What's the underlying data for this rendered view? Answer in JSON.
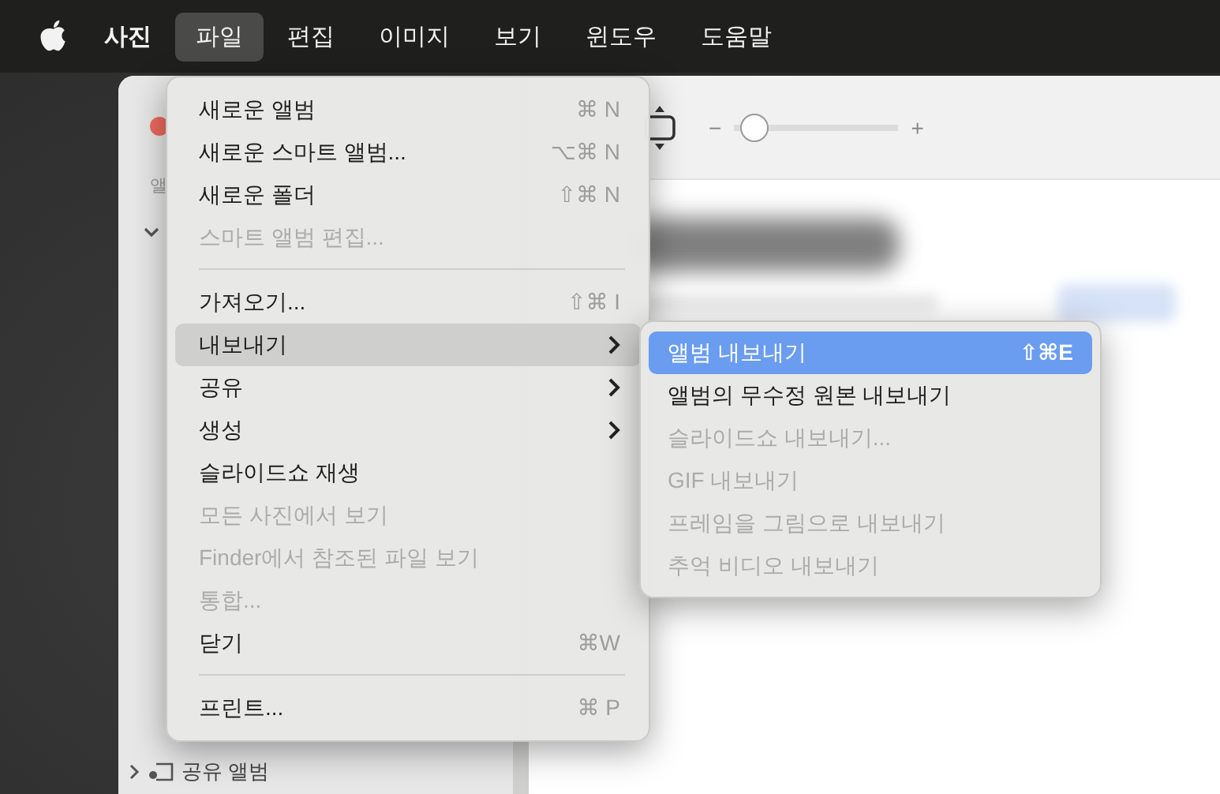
{
  "menu_bar": {
    "items": [
      {
        "label": "사진",
        "kind": "app",
        "selected": false
      },
      {
        "label": "파일",
        "kind": "menu",
        "selected": true
      },
      {
        "label": "편집",
        "kind": "menu",
        "selected": false
      },
      {
        "label": "이미지",
        "kind": "menu",
        "selected": false
      },
      {
        "label": "보기",
        "kind": "menu",
        "selected": false
      },
      {
        "label": "윈도우",
        "kind": "menu",
        "selected": false
      },
      {
        "label": "도움말",
        "kind": "menu",
        "selected": false
      }
    ]
  },
  "window": {
    "sidebar": {
      "heading": "앨",
      "items": [
        {
          "label": "공유 앨범",
          "expanded": false
        }
      ]
    }
  },
  "file_menu": {
    "items": [
      {
        "kind": "item",
        "label": "새로운 앨범",
        "shortcut": "⌘ N",
        "disabled": false,
        "selected": false,
        "submenu": false
      },
      {
        "kind": "item",
        "label": "새로운 스마트 앨범...",
        "shortcut": "⌥⌘ N",
        "disabled": false,
        "selected": false,
        "submenu": false
      },
      {
        "kind": "item",
        "label": "새로운 폴더",
        "shortcut": "⇧⌘ N",
        "disabled": false,
        "selected": false,
        "submenu": false
      },
      {
        "kind": "item",
        "label": "스마트 앨범 편집...",
        "disabled": true,
        "selected": false,
        "submenu": false
      },
      {
        "kind": "separator"
      },
      {
        "kind": "item",
        "label": "가져오기...",
        "shortcut": "⇧⌘ I",
        "disabled": false,
        "selected": false,
        "submenu": false
      },
      {
        "kind": "item",
        "label": "내보내기",
        "disabled": false,
        "selected": true,
        "submenu": true
      },
      {
        "kind": "item",
        "label": "공유",
        "disabled": false,
        "selected": false,
        "submenu": true
      },
      {
        "kind": "item",
        "label": "생성",
        "disabled": false,
        "selected": false,
        "submenu": true
      },
      {
        "kind": "item",
        "label": "슬라이드쇼 재생",
        "disabled": false,
        "selected": false,
        "submenu": false
      },
      {
        "kind": "item",
        "label": "모든 사진에서 보기",
        "disabled": true,
        "selected": false,
        "submenu": false
      },
      {
        "kind": "item",
        "label": "Finder에서 참조된 파일 보기",
        "disabled": true,
        "selected": false,
        "submenu": false
      },
      {
        "kind": "item",
        "label": "통합...",
        "disabled": true,
        "selected": false,
        "submenu": false
      },
      {
        "kind": "item",
        "label": "닫기",
        "shortcut": "⌘W",
        "disabled": false,
        "selected": false,
        "submenu": false
      },
      {
        "kind": "separator"
      },
      {
        "kind": "item",
        "label": "프린트...",
        "shortcut": "⌘ P",
        "disabled": false,
        "selected": false,
        "submenu": false
      }
    ]
  },
  "export_submenu": {
    "items": [
      {
        "kind": "item",
        "label": "앨범 내보내기",
        "shortcut": "⇧⌘E",
        "disabled": false,
        "selected": true,
        "submenu": false
      },
      {
        "kind": "item",
        "label": "앨범의 무수정 원본 내보내기",
        "disabled": false,
        "selected": false,
        "submenu": false
      },
      {
        "kind": "item",
        "label": "슬라이드쇼 내보내기...",
        "disabled": true,
        "selected": false,
        "submenu": false
      },
      {
        "kind": "item",
        "label": "GIF 내보내기",
        "disabled": true,
        "selected": false,
        "submenu": false
      },
      {
        "kind": "item",
        "label": "프레임을 그림으로 내보내기",
        "disabled": true,
        "selected": false,
        "submenu": false
      },
      {
        "kind": "item",
        "label": "추억 비디오 내보내기",
        "disabled": true,
        "selected": false,
        "submenu": false
      }
    ]
  },
  "toolbar": {
    "zoom_minus": "−",
    "zoom_plus": "+",
    "zoom_slider": {
      "level": 0.05
    }
  }
}
